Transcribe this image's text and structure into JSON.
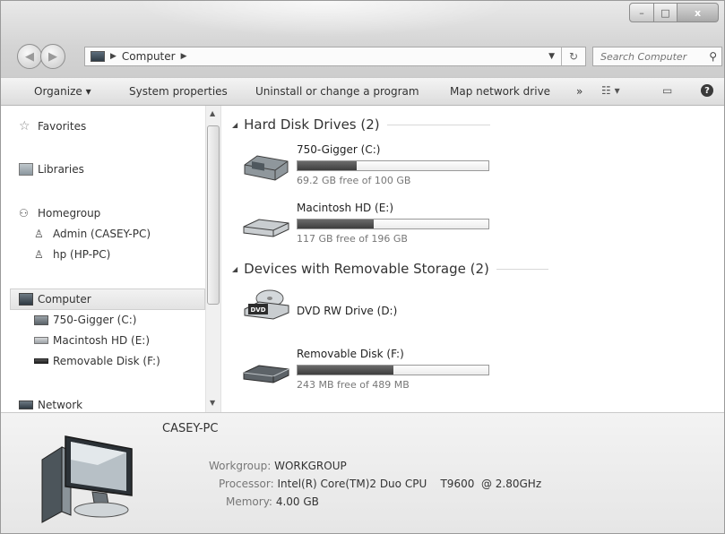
{
  "window": {
    "caption_buttons": {
      "minimize": "–",
      "maximize": "□",
      "close": "x"
    }
  },
  "address_bar": {
    "icon": "computer-icon",
    "breadcrumb": [
      "Computer"
    ],
    "search_placeholder": "Search Computer"
  },
  "toolbar": {
    "items": [
      "Organize ▾",
      "System properties",
      "Uninstall or change a program",
      "Map network drive",
      "»"
    ]
  },
  "nav": {
    "favorites": "Favorites",
    "libraries": "Libraries",
    "homegroup": "Homegroup",
    "homegroup_items": [
      "Admin (CASEY-PC)",
      "hp (HP-PC)"
    ],
    "computer": "Computer",
    "computer_items": [
      "750-Gigger (C:)",
      "Macintosh HD (E:)",
      "Removable Disk (F:)"
    ],
    "network": "Network"
  },
  "content": {
    "groups": [
      {
        "title": "Hard Disk Drives (2)",
        "drives": [
          {
            "name": "750-Gigger (C:)",
            "free_text": "69.2 GB free of 100 GB",
            "used_fraction": 0.31,
            "icon": "hard-drive-icon"
          },
          {
            "name": "Macintosh HD (E:)",
            "free_text": "117 GB free of 196 GB",
            "used_fraction": 0.4,
            "icon": "hard-drive-icon"
          }
        ]
      },
      {
        "title": "Devices with Removable Storage (2)",
        "drives": [
          {
            "name": "DVD RW Drive (D:)",
            "icon": "dvd-drive-icon"
          },
          {
            "name": "Removable Disk (F:)",
            "free_text": "243 MB free of 489 MB",
            "used_fraction": 0.5,
            "icon": "removable-disk-icon"
          }
        ]
      }
    ]
  },
  "details": {
    "pc_name": "CASEY-PC",
    "workgroup_label": "Workgroup:",
    "workgroup": "WORKGROUP",
    "processor_label": "Processor:",
    "processor": "Intel(R) Core(TM)2 Duo CPU    T9600  @ 2.80GHz",
    "memory_label": "Memory:",
    "memory": "4.00 GB"
  },
  "colors": {
    "bar_fill": "#4a4a4a",
    "selection": "#e6e6e6"
  }
}
